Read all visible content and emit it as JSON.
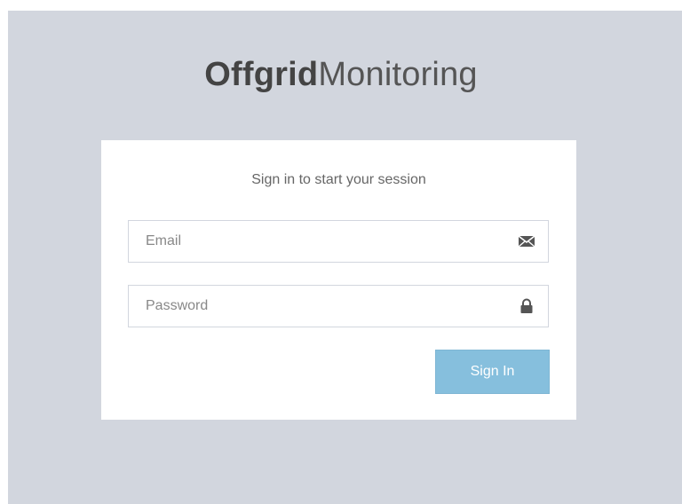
{
  "logo": {
    "bold_text": "Offgrid",
    "light_text": "Monitoring"
  },
  "login": {
    "message": "Sign in to start your session",
    "email": {
      "placeholder": "Email",
      "value": "",
      "icon": "envelope-icon"
    },
    "password": {
      "placeholder": "Password",
      "value": "",
      "icon": "lock-icon"
    },
    "submit_label": "Sign In"
  },
  "colors": {
    "page_background": "#d2d6de",
    "box_background": "#ffffff",
    "button_background": "#86bfdd",
    "button_text": "#ffffff",
    "logo_text": "#444444"
  }
}
